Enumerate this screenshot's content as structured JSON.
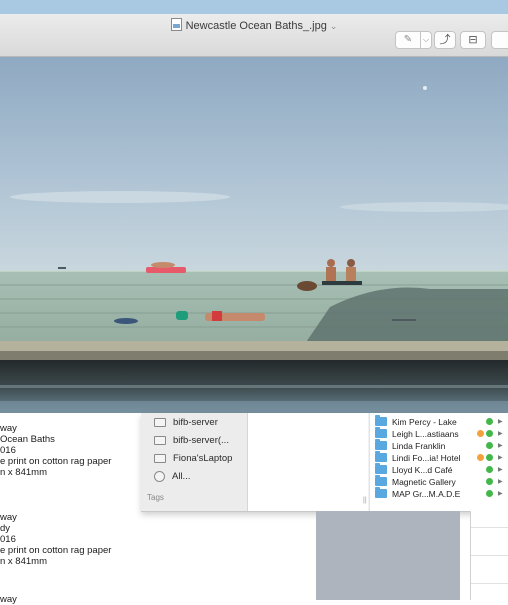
{
  "window": {
    "title": "Newcastle Ocean Baths_.jpg",
    "title_chevron": "⌄"
  },
  "toolbar": {
    "markup_dropdown_glyph": "⌵",
    "pen_glyph": "✎",
    "rotate_glyph": "⤴",
    "toolbox_glyph": "⊟"
  },
  "document": {
    "lines": [
      "way",
      " Ocean Baths",
      "016",
      "e print on cotton rag paper",
      "n x 841mm",
      "way",
      "dy",
      "016",
      "e print on cotton rag paper",
      "n x 841mm",
      "way"
    ]
  },
  "finder": {
    "sidebar_items": [
      {
        "label": "bifb-server",
        "icon": "display-icon"
      },
      {
        "label": "bifb-server(...",
        "icon": "server-icon"
      },
      {
        "label": "Fiona'sLaptop",
        "icon": "laptop-icon"
      },
      {
        "label": "All...",
        "icon": "globe-icon"
      }
    ],
    "tags_heading": "Tags",
    "folders": [
      {
        "name": "Kim Percy - Lake",
        "tags": [
          "green"
        ]
      },
      {
        "name": "Leigh L...astiaans",
        "tags": [
          "orange",
          "green"
        ]
      },
      {
        "name": "Linda Franklin",
        "tags": [
          "green"
        ]
      },
      {
        "name": "Lindi Fo...ia! Hotel",
        "tags": [
          "orange",
          "green"
        ]
      },
      {
        "name": "Lloyd K...d Café",
        "tags": [
          "green"
        ]
      },
      {
        "name": "Magnetic Gallery",
        "tags": [
          "green"
        ]
      },
      {
        "name": "MAP Gr...M.A.D.E",
        "tags": [
          "green"
        ]
      }
    ]
  },
  "colors": {
    "folder": "#5aa8e0",
    "tag_green": "#43b74a",
    "tag_orange": "#f3a03d"
  }
}
